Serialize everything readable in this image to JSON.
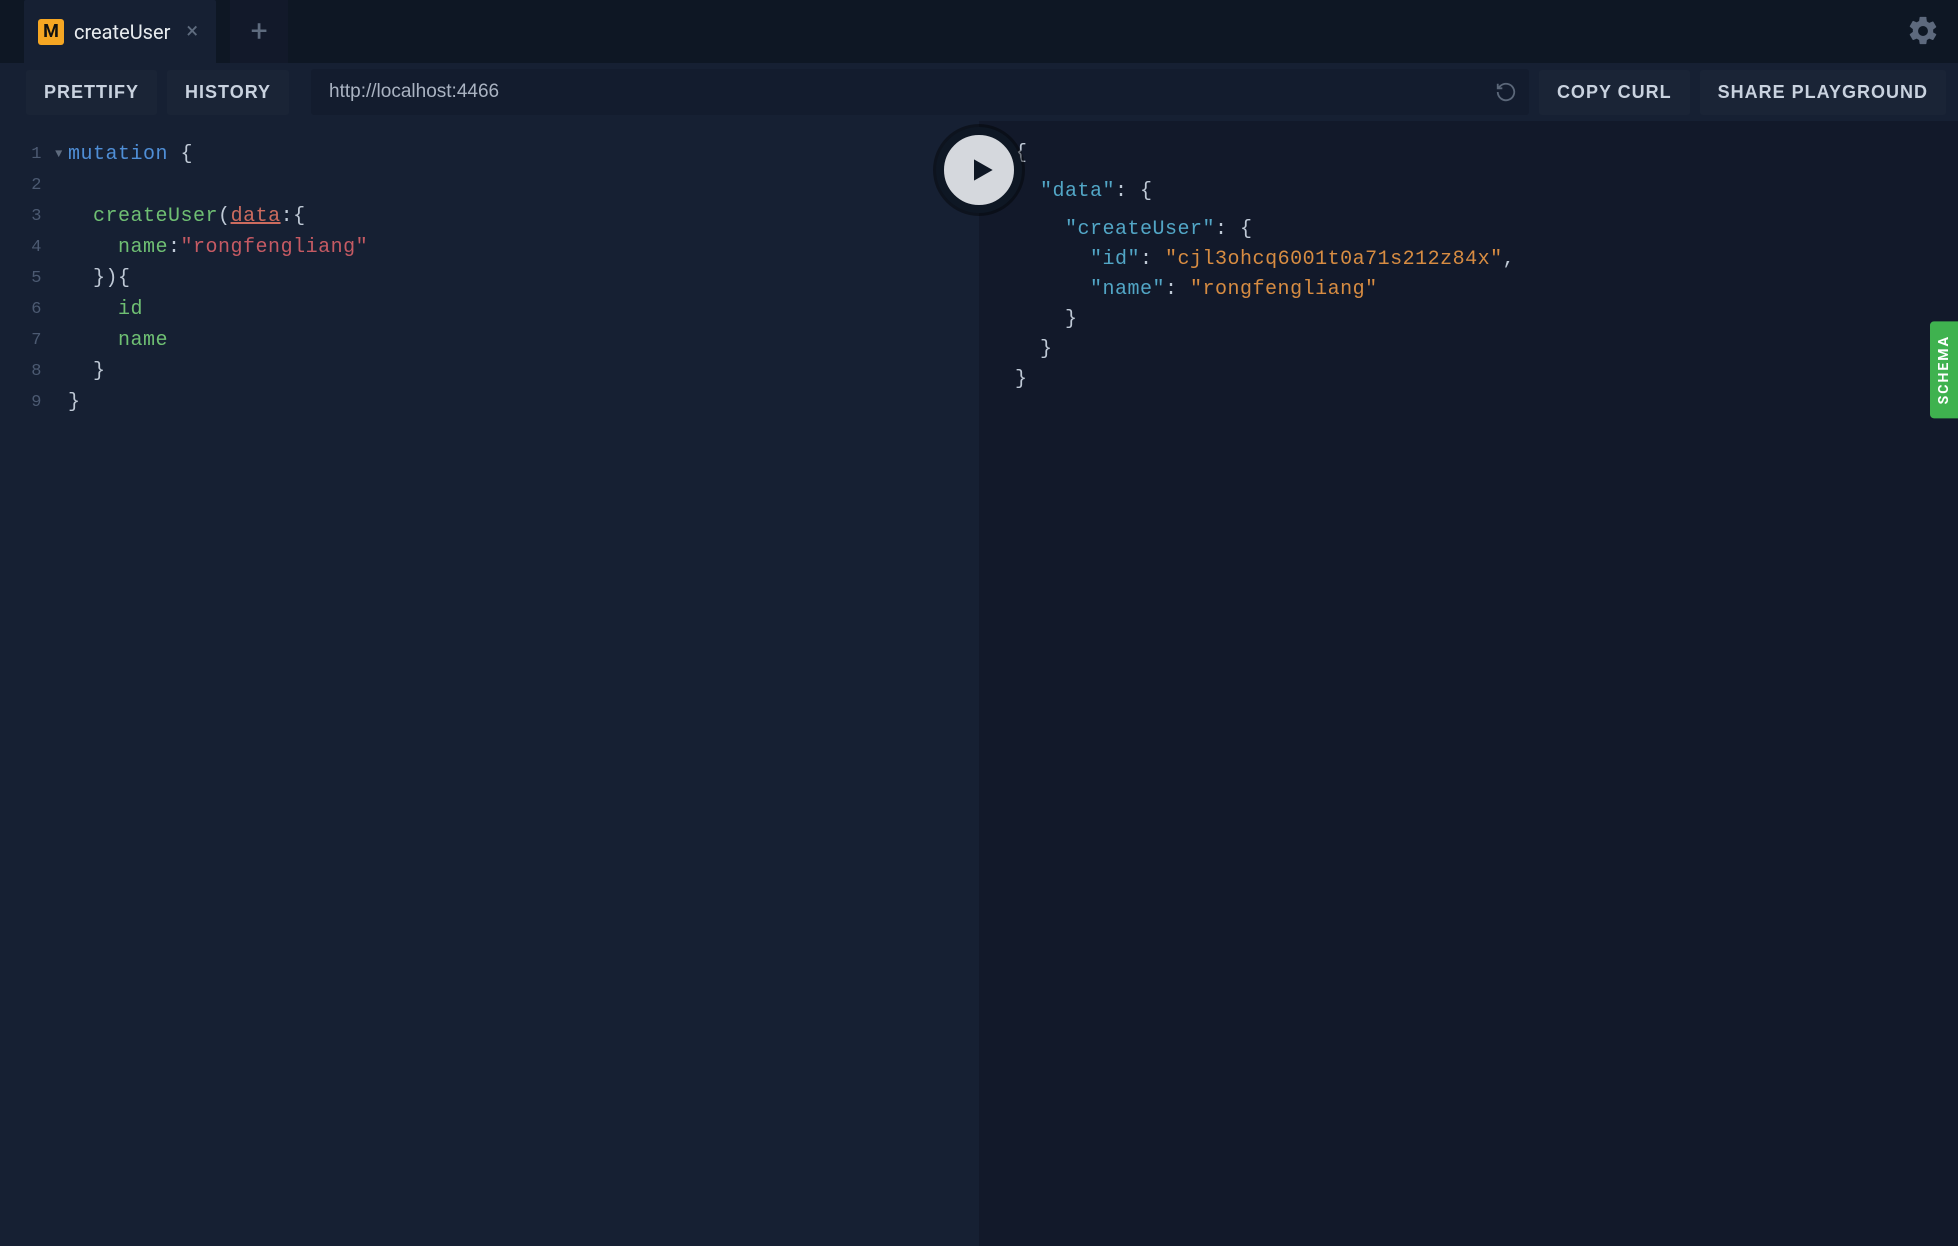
{
  "tab": {
    "badge": "M",
    "title": "createUser"
  },
  "toolbar": {
    "prettify": "PRETTIFY",
    "history": "HISTORY",
    "endpoint": "http://localhost:4466",
    "copy_curl": "COPY CURL",
    "share": "SHARE PLAYGROUND"
  },
  "schema_label": "SCHEMA",
  "query": {
    "keyword": "mutation",
    "fieldName": "createUser",
    "argName": "data",
    "propName": "name",
    "propValue": "\"rongfengliang\"",
    "sel1": "id",
    "sel2": "name",
    "l1_suffix": " {",
    "l2": "",
    "l3_prefix": "  ",
    "l3_mid": "(",
    "l3_after_arg": ":{",
    "l4_prefix": "    ",
    "l4_colon": ":",
    "l5": "  }){",
    "l6_prefix": "    ",
    "l7_prefix": "    ",
    "l8": "  }",
    "l9": "}",
    "line_numbers": {
      "n1": "1",
      "n2": "2",
      "n3": "3",
      "n4": "4",
      "n5": "5",
      "n6": "6",
      "n7": "7",
      "n8": "8",
      "n9": "9"
    }
  },
  "response": {
    "open": "{",
    "data_key": "\"data\"",
    "user_key": "\"createUser\"",
    "id_key": "\"id\"",
    "id_val": "\"cjl3ohcq6001t0a71s212z84x\"",
    "name_key": "\"name\"",
    "name_val": "\"rongfengliang\"",
    "colon_brace": ": {",
    "colon": ": ",
    "comma": ",",
    "close3": "    }",
    "close2": "  }",
    "close1": "}",
    "ind1": "  ",
    "ind2": "    ",
    "ind3": "      "
  }
}
